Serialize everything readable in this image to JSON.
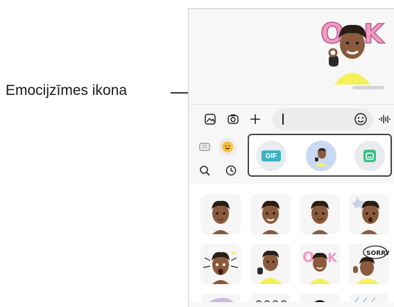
{
  "callout": {
    "label": "Emocijzīmes ikona"
  },
  "toolbar": {
    "gallery_icon": "image-icon",
    "camera_icon": "camera-icon",
    "add_icon": "plus-icon",
    "emoji_icon": "smiley-icon",
    "voice_icon": "voice-wave-icon"
  },
  "sticker_bar": {
    "gif_label": "GIF",
    "items": [
      "gif-button",
      "ar-emoji-sticker-button",
      "sticker-button"
    ]
  },
  "panel_tabs": [
    "keyboard-icon",
    "emoji-icon",
    "search-icon",
    "recent-icon"
  ],
  "stickers": [
    "neutral-face",
    "smile-face",
    "smirk-face",
    "wow-burst",
    "shocked-burst",
    "waving",
    "ok-sign",
    "sorry-bubble"
  ],
  "colors": {
    "shirt": "#f5f15a",
    "skin": "#8b5a3c",
    "hair": "#2a1d15",
    "highlight": "#444444",
    "active_tab": "#f6c244"
  }
}
